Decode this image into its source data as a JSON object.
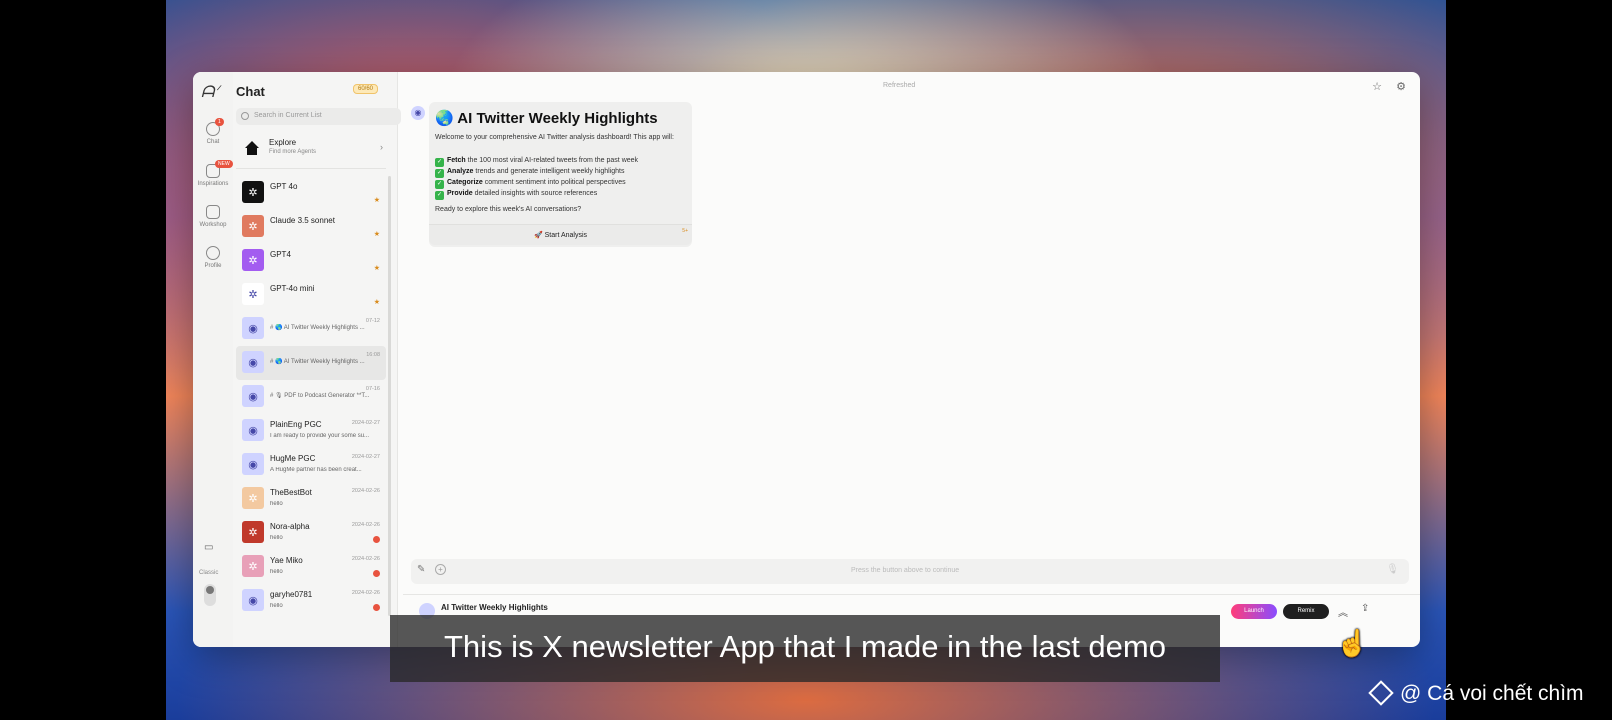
{
  "sidebar": {
    "title": "Chat",
    "credit": "60/60",
    "search_placeholder": "Search in Current List",
    "rail": {
      "chat": "Chat",
      "chat_badge": "1",
      "inspirations": "Inspirations",
      "inspirations_badge": "NEW",
      "workshop": "Workshop",
      "profile": "Profile",
      "classic": "Classic"
    },
    "explore": {
      "title": "Explore",
      "subtitle": "Find more Agents"
    },
    "items": [
      {
        "name": "GPT 4o",
        "preview": "",
        "date": "",
        "color": "#111111",
        "marker": "star"
      },
      {
        "name": "Claude 3.5 sonnet",
        "preview": "",
        "date": "",
        "color": "#e07a5f",
        "marker": "star"
      },
      {
        "name": "GPT4",
        "preview": "",
        "date": "",
        "color": "#a35cf0",
        "marker": "star"
      },
      {
        "name": "GPT-4o mini",
        "preview": "",
        "date": "",
        "color": "#ffffff",
        "marker": "star"
      },
      {
        "name": "",
        "preview": "# 🌎 AI Twitter Weekly Highlights ...",
        "date": "07-12",
        "color": "#cfd3ff",
        "marker": ""
      },
      {
        "name": "",
        "preview": "# 🌎 AI Twitter Weekly Highlights ...",
        "date": "16:08",
        "color": "#cfd3ff",
        "marker": ""
      },
      {
        "name": "",
        "preview": "# 🎙 PDF to Podcast Generator **T...",
        "date": "07-16",
        "color": "#cfd3ff",
        "marker": ""
      },
      {
        "name": "PlainEng PGC",
        "preview": "I am ready to provide your some su...",
        "date": "2024-02-27",
        "color": "#cfd3ff",
        "marker": ""
      },
      {
        "name": "HugMe PGC",
        "preview": "A HugMe partner has been creat...",
        "date": "2024-02-27",
        "color": "#cfd3ff",
        "marker": ""
      },
      {
        "name": "TheBestBot",
        "preview": "hello",
        "date": "2024-02-26",
        "color": "#f3c9a0",
        "marker": ""
      },
      {
        "name": "Nora-alpha",
        "preview": "hello",
        "date": "2024-02-26",
        "color": "#c0392b",
        "marker": "unread"
      },
      {
        "name": "Yae Miko",
        "preview": "hello",
        "date": "2024-02-26",
        "color": "#e8a0b8",
        "marker": "unread"
      },
      {
        "name": "garyhe0781",
        "preview": "hello",
        "date": "2024-02-26",
        "color": "#cfd3ff",
        "marker": "unread"
      }
    ]
  },
  "main": {
    "status": "Refreshed",
    "card": {
      "title": "🌏 AI Twitter Weekly Highlights",
      "intro": "Welcome to your comprehensive AI Twitter analysis dashboard! This app will:",
      "features": [
        {
          "bold": "Fetch",
          "rest": " the 100 most viral AI-related tweets from the past week"
        },
        {
          "bold": "Analyze",
          "rest": " trends and generate intelligent weekly highlights"
        },
        {
          "bold": "Categorize",
          "rest": " comment sentiment into political perspectives"
        },
        {
          "bold": "Provide",
          "rest": " detailed insights with source references"
        }
      ],
      "outro": "Ready to explore this week's AI conversations?",
      "button": "🚀 Start Analysis",
      "button_badge": "5+"
    },
    "input_placeholder": "Press the button above to continue",
    "bottom_title": "AI Twitter Weekly Highlights",
    "launch_label": "Launch",
    "remix_label": "Remix"
  },
  "overlay": {
    "subtitle": "This is X newsletter App that I made in the last demo",
    "watermark": "@ Cá voi chết chìm"
  }
}
